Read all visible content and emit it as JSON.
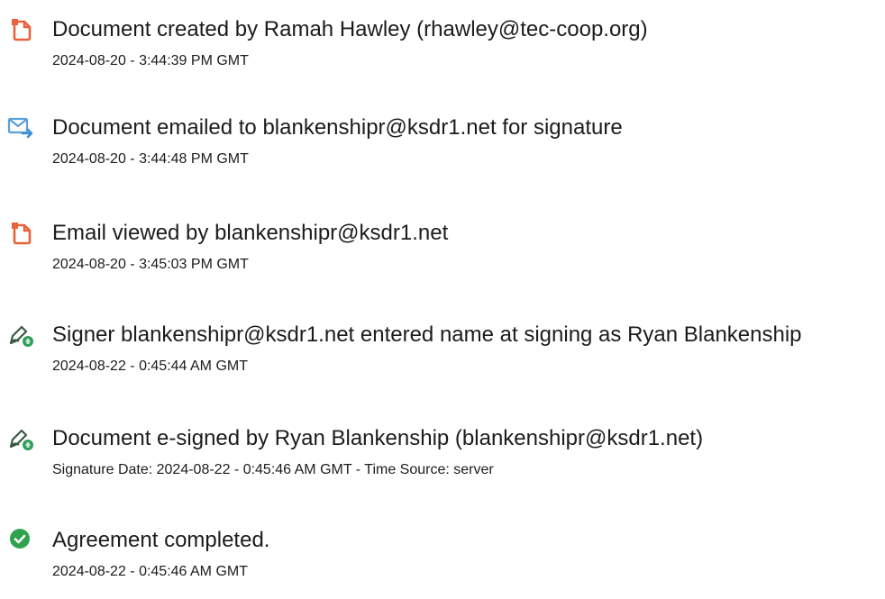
{
  "events": [
    {
      "icon": "document-icon",
      "title": "Document created by Ramah Hawley (rhawley@tec-coop.org)",
      "detail": "2024-08-20 - 3:44:39 PM GMT"
    },
    {
      "icon": "email-sent-icon",
      "title": "Document emailed to blankenshipr@ksdr1.net for signature",
      "detail": "2024-08-20 - 3:44:48 PM GMT"
    },
    {
      "icon": "document-icon",
      "title": "Email viewed by blankenshipr@ksdr1.net",
      "detail": "2024-08-20 - 3:45:03 PM GMT"
    },
    {
      "icon": "esign-pen-icon",
      "title": "Signer blankenshipr@ksdr1.net entered name at signing as Ryan Blankenship",
      "detail": "2024-08-22 - 0:45:44 AM GMT"
    },
    {
      "icon": "esign-pen-icon",
      "title": "Document e-signed by Ryan Blankenship (blankenshipr@ksdr1.net)",
      "detail": "Signature Date: 2024-08-22 - 0:45:46 AM GMT - Time Source: server"
    },
    {
      "icon": "check-circle-icon",
      "title": "Agreement completed.",
      "detail": "2024-08-22 - 0:45:46 AM GMT"
    }
  ],
  "colors": {
    "document_icon": "#e8623c",
    "email_icon": "#3a8fd6",
    "pen_icon": "#2f9e5a",
    "check_icon": "#2fa24f",
    "text": "#1c1c1c"
  }
}
